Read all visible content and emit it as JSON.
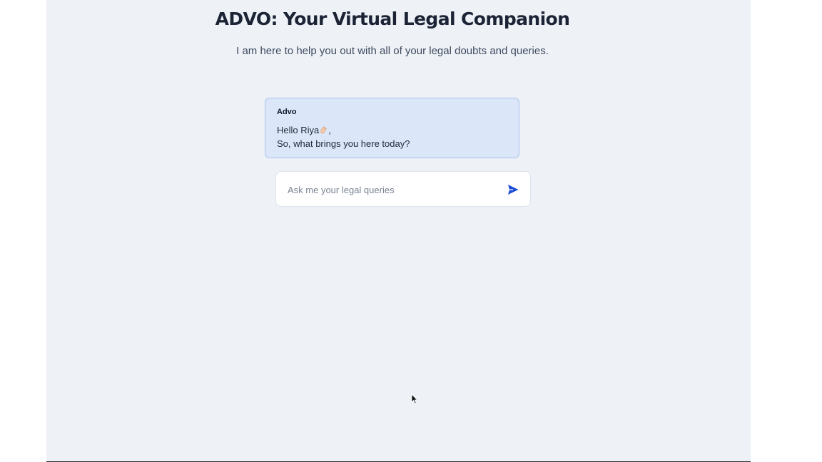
{
  "header": {
    "title": "ADVO: Your Virtual Legal Companion",
    "subtitle": "I am here to help you out with all of your legal doubts and queries."
  },
  "chat": {
    "messages": [
      {
        "sender": "Advo",
        "lines": [
          "Hello Riya",
          "So, what brings you here today?"
        ],
        "line1_suffix": ",",
        "emoji_icon": "waving-hand-icon"
      }
    ]
  },
  "composer": {
    "placeholder": "Ask me your legal queries",
    "value": "",
    "send_icon": "send-icon",
    "send_color": "#1d4ed8"
  },
  "colors": {
    "background": "#eef2f7",
    "bubble": "#dbe6f8",
    "bubble_border": "#a9c3ec",
    "title": "#1b2335"
  }
}
